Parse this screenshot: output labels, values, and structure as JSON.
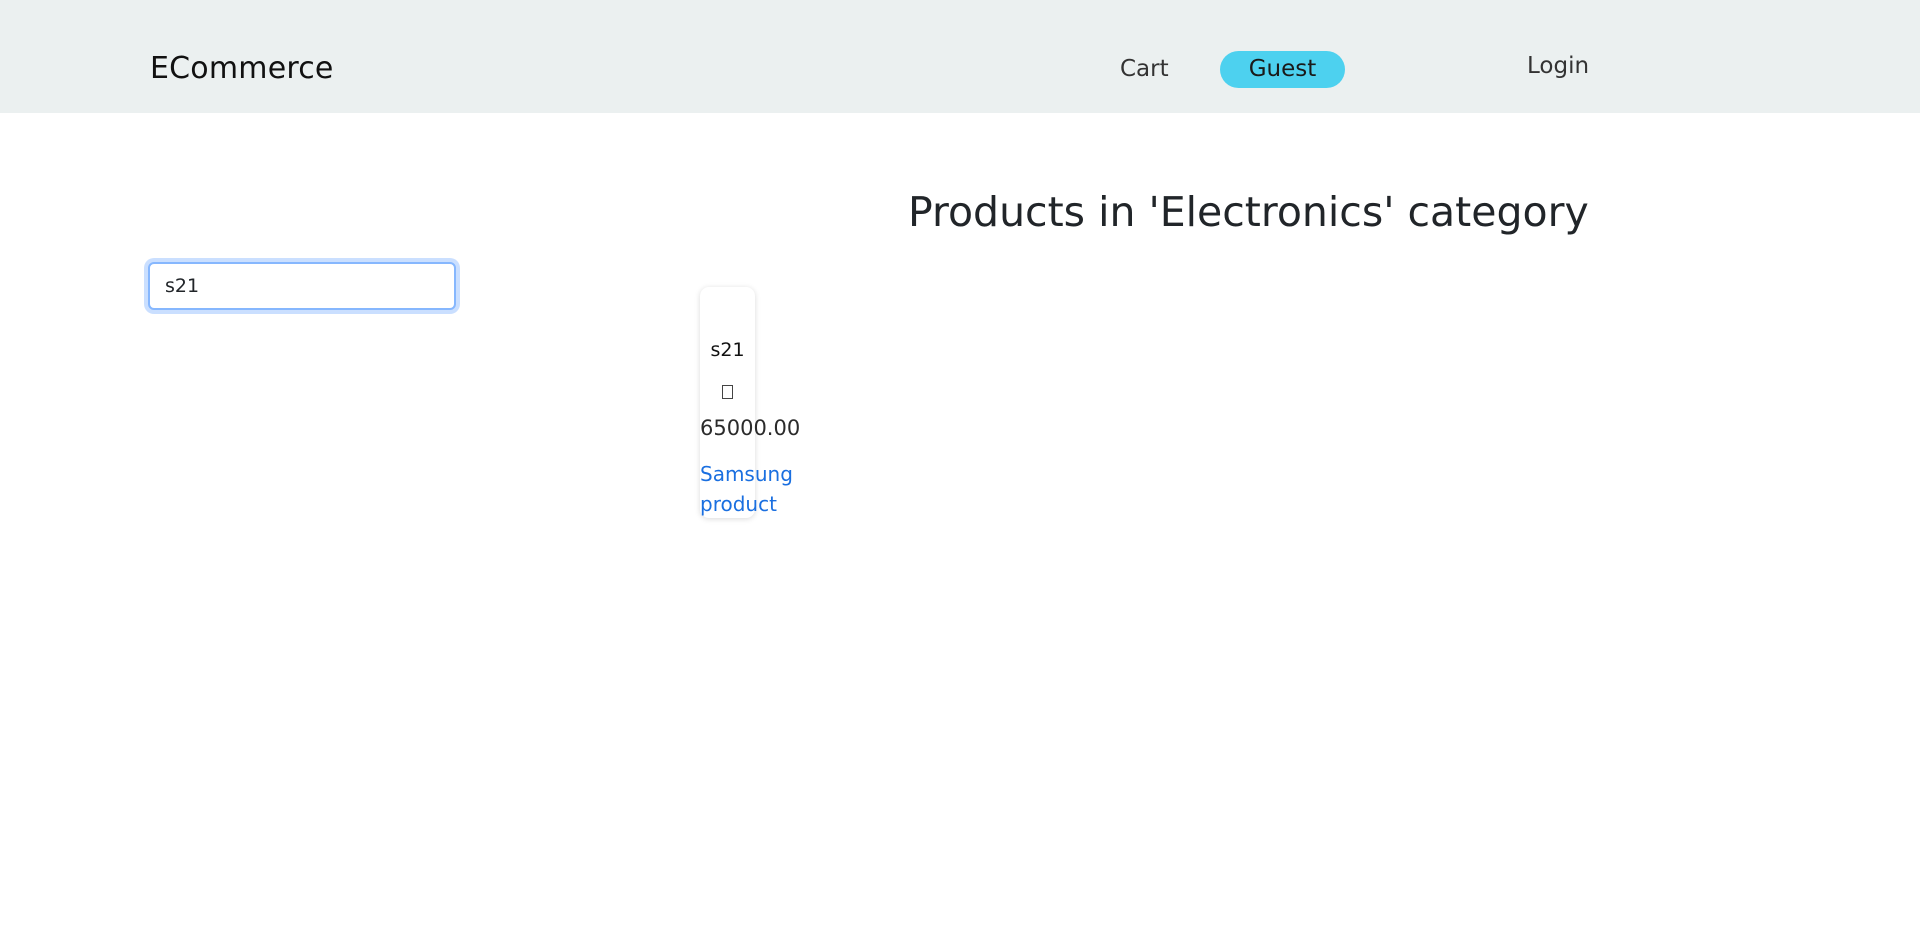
{
  "navbar": {
    "brand": "ECommerce",
    "cart_label": "Cart",
    "user_label": "Guest",
    "login_label": "Login",
    "user_badge_color": "#4dd1ef",
    "background_color": "#ebf0f0"
  },
  "main": {
    "title": "Products in 'Electronics' category",
    "search": {
      "value": "s21",
      "placeholder": ""
    },
    "products": [
      {
        "name": "s21",
        "currency_icon": "currency-icon",
        "price": "65000.00",
        "link_label": "Samsung product"
      }
    ]
  },
  "colors": {
    "link": "#1a6fe0",
    "focus_border": "#86b7fe"
  }
}
